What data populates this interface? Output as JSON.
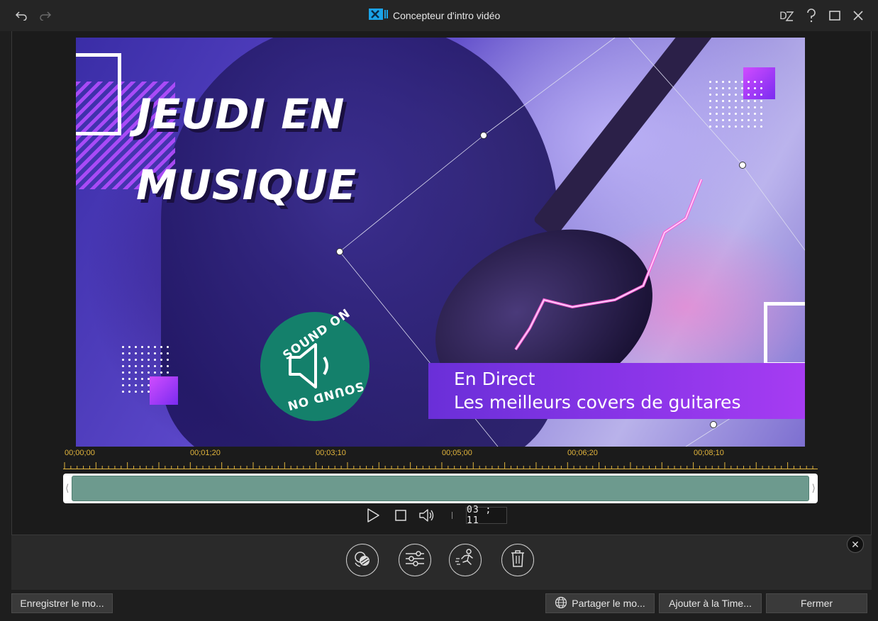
{
  "window": {
    "title": "Concepteur d'intro vidéo",
    "icons": {
      "undo": "undo-icon",
      "redo": "redo-icon",
      "app": "app-logo-icon",
      "dz": "dz-icon",
      "help": "help-icon",
      "maximize": "maximize-icon",
      "close": "close-icon"
    }
  },
  "preview": {
    "headline_line1": "JEUDI EN",
    "headline_line2": "MUSIQUE",
    "badge_top": "SOUND ON",
    "badge_bottom": "SOUND ON",
    "lower_third_line1": "En Direct",
    "lower_third_line2": "Les meilleurs covers de guitares"
  },
  "timeline": {
    "ticks": [
      "00;00;00",
      "00;01;20",
      "00;03;10",
      "00;05;00",
      "00;06;20",
      "00;08;10"
    ],
    "current_time": "03 ; 11"
  },
  "tools": [
    {
      "name": "replace-tool",
      "icon": "replace-media-icon"
    },
    {
      "name": "adjust-tool",
      "icon": "sliders-icon"
    },
    {
      "name": "motion-tool",
      "icon": "motion-runner-icon"
    },
    {
      "name": "delete-tool",
      "icon": "trash-icon"
    }
  ],
  "footer": {
    "save_label": "Enregistrer le mo...",
    "share_label": "Partager le mo...",
    "add_label": "Ajouter à la Time...",
    "close_label": "Fermer"
  },
  "colors": {
    "accent_timeline": "#e2b53c",
    "clip": "#6d9a8e",
    "badge": "#14806b",
    "lower_third": "#8a35e8"
  }
}
